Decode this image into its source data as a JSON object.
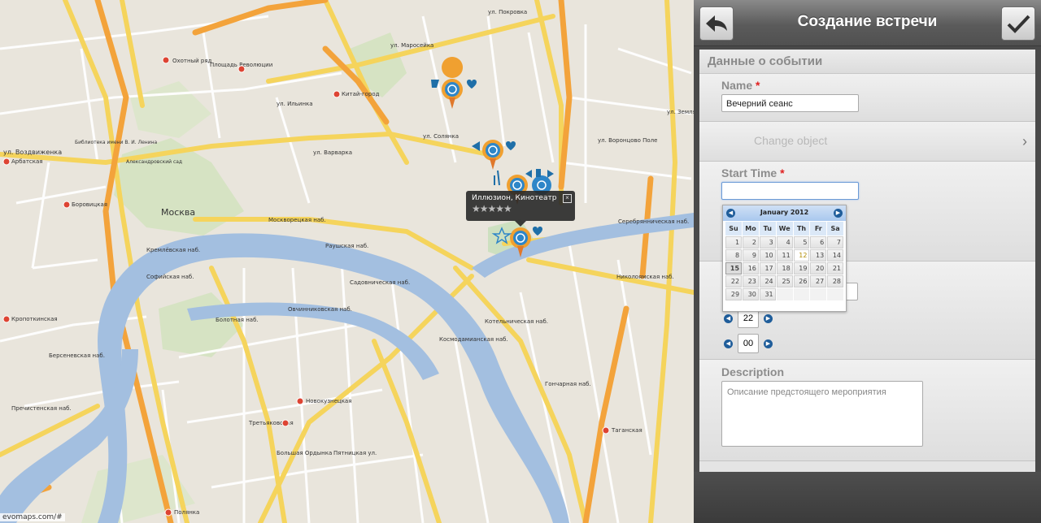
{
  "map": {
    "labels": {
      "moscow": "Москва",
      "okhotny": "Охотный ряд",
      "ploshchad": "Площадь Революции",
      "kitai": "Китай-город",
      "library": "Библиотека имени В. И. Ленина",
      "alexandrovsky": "Александровский сад",
      "arbatskaya": "Арбатская",
      "borovitskaya": "Боровицкая",
      "kropotkinskaya": "Кропоткинская",
      "polyanka": "Полянка",
      "tretyakovskaya": "Третьяковская",
      "novokuznetskaya": "Новокузнецкая",
      "taganskaya": "Таганская",
      "vozdvizhenka": "ул. Воздвиженка",
      "varvarka": "ул. Варварка",
      "moskvoretskaya": "Москворецкая наб.",
      "kremlevskaya": "Кремлёвская наб.",
      "sofiyskaya": "Софийская наб.",
      "raushskaya": "Раушская наб.",
      "sadovnicheskaya": "Садовническая наб.",
      "ovchinnikovskaya": "Овчинниковская наб.",
      "bolotnaya": "Болотная наб.",
      "kotelnicheskaya": "Котельническая наб.",
      "kosmodamianskaya": "Космодамианская наб.",
      "bersenevskaya": "Берсеневская наб.",
      "prechistenskaya": "Пречистенская наб.",
      "goncharnaya": "Гончарная наб.",
      "serebryanicheskaya": "Серебрянническая наб.",
      "nikolo": "Николоямская наб.",
      "bolshaya_ordynka": "Большая Ордынка",
      "pyatnitskaya": "Пятницкая ул.",
      "zemlyanoy": "ул. Земляной Вал",
      "solyanka": "ул. Солянка",
      "maroseyka": "ул. Маросейка",
      "pokrovka": "ул. Покровка",
      "vorontsovo": "ул. Воронцово Поле",
      "ilyinka": "ул. Ильинка"
    },
    "attribution": "evomaps.com/#",
    "popup": {
      "title": "Иллюзион, Кинотеатр",
      "close": "×",
      "stars": "★★★★★"
    }
  },
  "panel": {
    "title": "Создание встречи",
    "section": "Данные о событии",
    "name_label": "Name",
    "required": "*",
    "name_value": "Вечерний сеанс",
    "change_object": "Change object",
    "start_label": "Start Time",
    "start_value": "",
    "calendar": {
      "title": "January 2012",
      "weekdays": [
        "Su",
        "Mo",
        "Tu",
        "We",
        "Th",
        "Fr",
        "Sa"
      ],
      "weeks": [
        [
          "1",
          "2",
          "3",
          "4",
          "5",
          "6",
          "7"
        ],
        [
          "8",
          "9",
          "10",
          "11",
          "12",
          "13",
          "14"
        ],
        [
          "15",
          "16",
          "17",
          "18",
          "19",
          "20",
          "21"
        ],
        [
          "22",
          "23",
          "24",
          "25",
          "26",
          "27",
          "28"
        ],
        [
          "29",
          "30",
          "31",
          "",
          "",
          "",
          ""
        ]
      ],
      "today": "12",
      "selected": "15"
    },
    "hour": "22",
    "minute": "00",
    "description_label": "Description",
    "description_placeholder": "Описание предстоящего мероприятия"
  }
}
